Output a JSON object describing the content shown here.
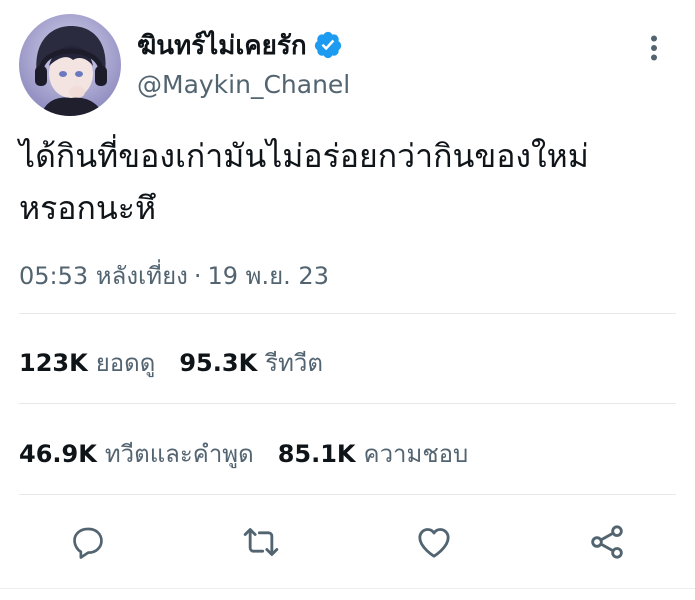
{
  "author": {
    "display_name": "ฆินทร์ไม่เคยรัก",
    "handle": "@Maykin_Chanel",
    "verified": true
  },
  "tweet": {
    "text": "ได้กินที่ของเก่ามันไม่อร่อยกว่ากินของใหม่\nหรอกนะหึ",
    "time": "05:53 หลังเที่ยง",
    "separator": "·",
    "date": "19 พ.ย. 23"
  },
  "stats": {
    "views": {
      "value": "123K",
      "label": "ยอดดู"
    },
    "retweets": {
      "value": "95.3K",
      "label": "รีทวีต"
    },
    "quotes": {
      "value": "46.9K",
      "label": "ทวีตและคำพูด"
    },
    "likes": {
      "value": "85.1K",
      "label": "ความชอบ"
    }
  },
  "icons": {
    "verified": "verified-badge-icon",
    "more": "more-vertical-icon",
    "reply": "reply-icon",
    "retweet": "retweet-icon",
    "like": "heart-icon",
    "share": "share-icon"
  },
  "colors": {
    "text": "#0f1419",
    "secondary": "#536471",
    "verified": "#1d9bf0",
    "divider": "#e6e9eb"
  }
}
